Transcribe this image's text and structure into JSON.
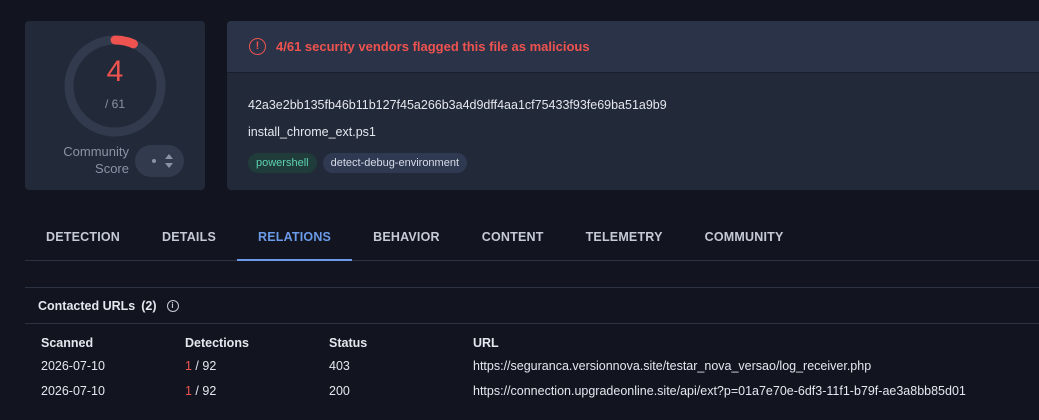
{
  "score": {
    "detections": "4",
    "total": "/ 61",
    "total_engines": 61,
    "community_label": "Community Score",
    "accent_color": "#ef5350"
  },
  "file": {
    "alert": "4/61 security vendors flagged this file as malicious",
    "alert_icon": "exclamation-circle-icon",
    "hash": "42a3e2bb135fb46b11b127f45a266b3a4d9dff4aa1cf75433f93fe69ba51a9b9",
    "name": "install_chrome_ext.ps1",
    "tags": [
      "powershell",
      "detect-debug-environment"
    ]
  },
  "tabs": [
    {
      "label": "DETECTION"
    },
    {
      "label": "DETAILS"
    },
    {
      "label": "RELATIONS",
      "active": true
    },
    {
      "label": "BEHAVIOR"
    },
    {
      "label": "CONTENT"
    },
    {
      "label": "TELEMETRY"
    },
    {
      "label": "COMMUNITY"
    }
  ],
  "relations": {
    "title": "Contacted URLs",
    "count": "(2)",
    "columns": [
      "Scanned",
      "Detections",
      "Status",
      "URL"
    ],
    "rows": [
      {
        "scanned": "2026-07-10",
        "detections_hit": "1",
        "detections_total": " / 92",
        "status": "403",
        "url": "https://seguranca.versionnova.site/testar_nova_versao/log_receiver.php"
      },
      {
        "scanned": "2026-07-10",
        "detections_hit": "1",
        "detections_total": " / 92",
        "status": "200",
        "url": "https://connection.upgradeonline.site/api/ext?p=01a7e70e-6df3-11f1-b79f-ae3a8bb85d01"
      }
    ]
  }
}
